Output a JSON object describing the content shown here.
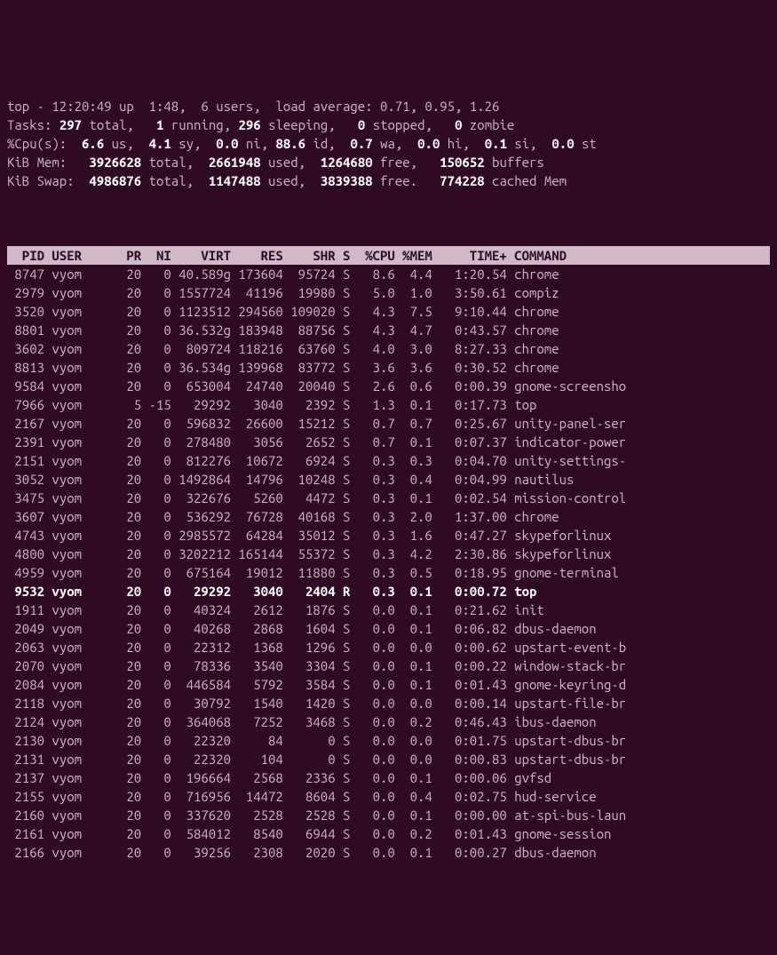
{
  "summary": {
    "line1_pre": "top - 12:20:49 up  1:48,  6 users,  load average: 0.71, 0.95, 1.26",
    "tasks_lbl": "Tasks: ",
    "tasks_total": "297 ",
    "tasks_total_lbl": "total,   ",
    "tasks_running": "1 ",
    "tasks_running_lbl": "running, ",
    "tasks_sleeping": "296 ",
    "tasks_sleeping_lbl": "sleeping,   ",
    "tasks_stopped": "0 ",
    "tasks_stopped_lbl": "stopped,   ",
    "tasks_zombie": "0 ",
    "tasks_zombie_lbl": "zombie",
    "cpu_lbl": "%Cpu(s):  ",
    "cpu_us": "6.6 ",
    "cpu_us_lbl": "us,  ",
    "cpu_sy": "4.1 ",
    "cpu_sy_lbl": "sy,  ",
    "cpu_ni": "0.0 ",
    "cpu_ni_lbl": "ni, ",
    "cpu_id": "88.6 ",
    "cpu_id_lbl": "id,  ",
    "cpu_wa": "0.7 ",
    "cpu_wa_lbl": "wa,  ",
    "cpu_hi": "0.0 ",
    "cpu_hi_lbl": "hi,  ",
    "cpu_si": "0.1 ",
    "cpu_si_lbl": "si,  ",
    "cpu_st": "0.0 ",
    "cpu_st_lbl": "st",
    "mem_lbl": "KiB Mem:   ",
    "mem_total": "3926628 ",
    "mem_total_lbl": "total,  ",
    "mem_used": "2661948 ",
    "mem_used_lbl": "used,  ",
    "mem_free": "1264680 ",
    "mem_free_lbl": "free,   ",
    "mem_buf": "150652 ",
    "mem_buf_lbl": "buffers",
    "swap_lbl": "KiB Swap:  ",
    "swap_total": "4986876 ",
    "swap_total_lbl": "total,  ",
    "swap_used": "1147488 ",
    "swap_used_lbl": "used,  ",
    "swap_free": "3839388 ",
    "swap_free_lbl": "free.   ",
    "swap_cache": "774228 ",
    "swap_cache_lbl": "cached Mem"
  },
  "header": "  PID USER      PR  NI    VIRT    RES    SHR S  %CPU %MEM     TIME+ COMMAND          ",
  "rows": [
    {
      "t": " 8747 vyom      20   0 40.589g 173604  95724 S   8.6  4.4   1:20.54 chrome"
    },
    {
      "t": " 2979 vyom      20   0 1557724  41196  19980 S   5.0  1.0   3:50.61 compiz"
    },
    {
      "t": " 3520 vyom      20   0 1123512 294560 109020 S   4.3  7.5   9:10.44 chrome"
    },
    {
      "t": " 8801 vyom      20   0 36.532g 183948  88756 S   4.3  4.7   0:43.57 chrome"
    },
    {
      "t": " 3602 vyom      20   0  809724 118216  63760 S   4.0  3.0   8:27.33 chrome"
    },
    {
      "t": " 8813 vyom      20   0 36.534g 139968  83772 S   3.6  3.6   0:30.52 chrome"
    },
    {
      "t": " 9584 vyom      20   0  653004  24740  20040 S   2.6  0.6   0:00.39 gnome-screensho"
    },
    {
      "t": " 7966 vyom       5 -15   29292   3040   2392 S   1.3  0.1   0:17.73 top"
    },
    {
      "t": " 2167 vyom      20   0  596832  26600  15212 S   0.7  0.7   0:25.67 unity-panel-ser"
    },
    {
      "t": " 2391 vyom      20   0  278480   3056   2652 S   0.7  0.1   0:07.37 indicator-power"
    },
    {
      "t": " 2151 vyom      20   0  812276  10672   6924 S   0.3  0.3   0:04.70 unity-settings-"
    },
    {
      "t": " 3052 vyom      20   0 1492864  14796  10248 S   0.3  0.4   0:04.99 nautilus"
    },
    {
      "t": " 3475 vyom      20   0  322676   5260   4472 S   0.3  0.1   0:02.54 mission-control"
    },
    {
      "t": " 3607 vyom      20   0  536292  76728  40168 S   0.3  2.0   1:37.00 chrome"
    },
    {
      "t": " 4743 vyom      20   0 2985572  64284  35012 S   0.3  1.6   0:47.27 skypeforlinux"
    },
    {
      "t": " 4800 vyom      20   0 3202212 165144  55372 S   0.3  4.2   2:30.86 skypeforlinux"
    },
    {
      "t": " 4959 vyom      20   0  675164  19012  11880 S   0.3  0.5   0:18.95 gnome-terminal"
    },
    {
      "t": " 9532 vyom      20   0   29292   3040   2404 R   0.3  0.1   0:00.72 top",
      "hl": true
    },
    {
      "t": " 1911 vyom      20   0   40324   2612   1876 S   0.0  0.1   0:21.62 init"
    },
    {
      "t": " 2049 vyom      20   0   40268   2868   1604 S   0.0  0.1   0:06.82 dbus-daemon"
    },
    {
      "t": " 2063 vyom      20   0   22312   1368   1296 S   0.0  0.0   0:00.62 upstart-event-b"
    },
    {
      "t": " 2070 vyom      20   0   78336   3540   3304 S   0.0  0.1   0:00.22 window-stack-br"
    },
    {
      "t": " 2084 vyom      20   0  446584   5792   3584 S   0.0  0.1   0:01.43 gnome-keyring-d"
    },
    {
      "t": " 2118 vyom      20   0   30792   1540   1420 S   0.0  0.0   0:00.14 upstart-file-br"
    },
    {
      "t": " 2124 vyom      20   0  364068   7252   3468 S   0.0  0.2   0:46.43 ibus-daemon"
    },
    {
      "t": " 2130 vyom      20   0   22320     84      0 S   0.0  0.0   0:01.75 upstart-dbus-br"
    },
    {
      "t": " 2131 vyom      20   0   22320    104      0 S   0.0  0.0   0:00.83 upstart-dbus-br"
    },
    {
      "t": " 2137 vyom      20   0  196664   2568   2336 S   0.0  0.1   0:00.06 gvfsd"
    },
    {
      "t": " 2155 vyom      20   0  716956  14472   8604 S   0.0  0.4   0:02.75 hud-service"
    },
    {
      "t": " 2160 vyom      20   0  337620   2528   2528 S   0.0  0.1   0:00.00 at-spi-bus-laun"
    },
    {
      "t": " 2161 vyom      20   0  584012   8540   6944 S   0.0  0.2   0:01.43 gnome-session"
    },
    {
      "t": " 2166 vyom      20   0   39256   2308   2020 S   0.0  0.1   0:00.27 dbus-daemon"
    }
  ]
}
